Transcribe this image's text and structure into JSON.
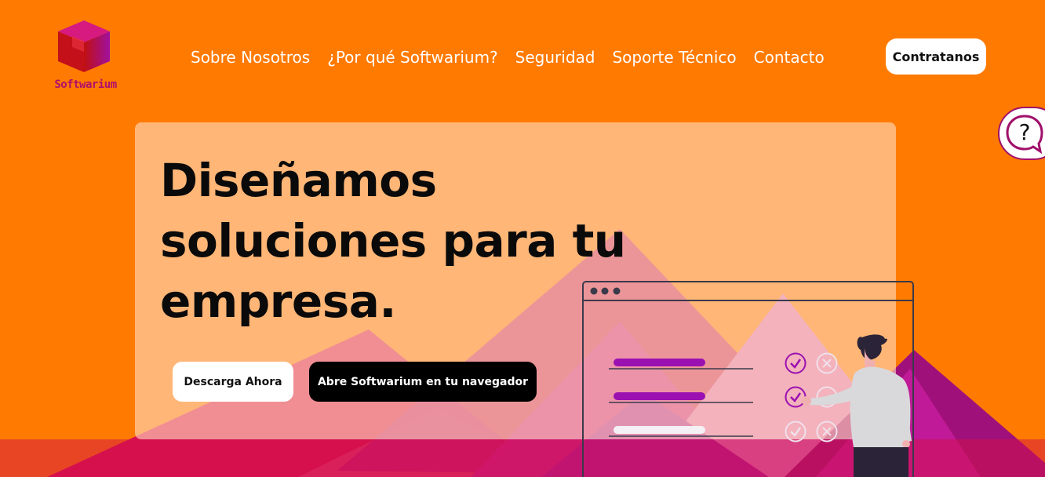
{
  "brand": {
    "name": "Softwarium",
    "colors": {
      "background": "#ff7a00",
      "accent": "#a0106a",
      "purple": "#9b10b0"
    }
  },
  "nav": {
    "items": [
      {
        "label": "Sobre Nosotros"
      },
      {
        "label": "¿Por qué Softwarium?"
      },
      {
        "label": "Seguridad"
      },
      {
        "label": "Soporte Técnico"
      },
      {
        "label": "Contacto"
      }
    ],
    "cta_label": "Contratanos"
  },
  "help": {
    "icon": "question-bubble-icon"
  },
  "hero": {
    "title": "Diseñamos soluciones para tu empresa.",
    "primary_button": "Descarga Ahora",
    "secondary_button": "Abre Softwarium en tu navegador"
  }
}
